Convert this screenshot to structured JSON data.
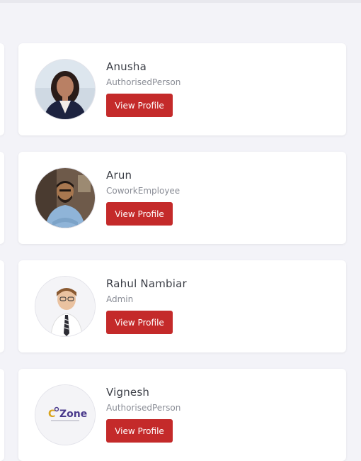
{
  "profiles": [
    {
      "name": "Anusha",
      "role": "AuthorisedPerson",
      "button_label": "View Profile",
      "avatar": "photo-woman-icon"
    },
    {
      "name": "Arun",
      "role": "CoworkEmployee",
      "button_label": "View Profile",
      "avatar": "photo-man-bearded-icon"
    },
    {
      "name": "Rahul Nambiar",
      "role": "Admin",
      "button_label": "View Profile",
      "avatar": "photo-man-tie-icon"
    },
    {
      "name": "Vignesh",
      "role": "AuthorisedPerson",
      "button_label": "View Profile",
      "avatar": "cozone-logo",
      "logo_text": "Zone",
      "logo_prefix": "C"
    }
  ],
  "colors": {
    "background": "#f3f3f8",
    "card": "#ffffff",
    "button": "#c42a2a",
    "name_text": "#3c3f47",
    "role_text": "#8a8d96"
  }
}
